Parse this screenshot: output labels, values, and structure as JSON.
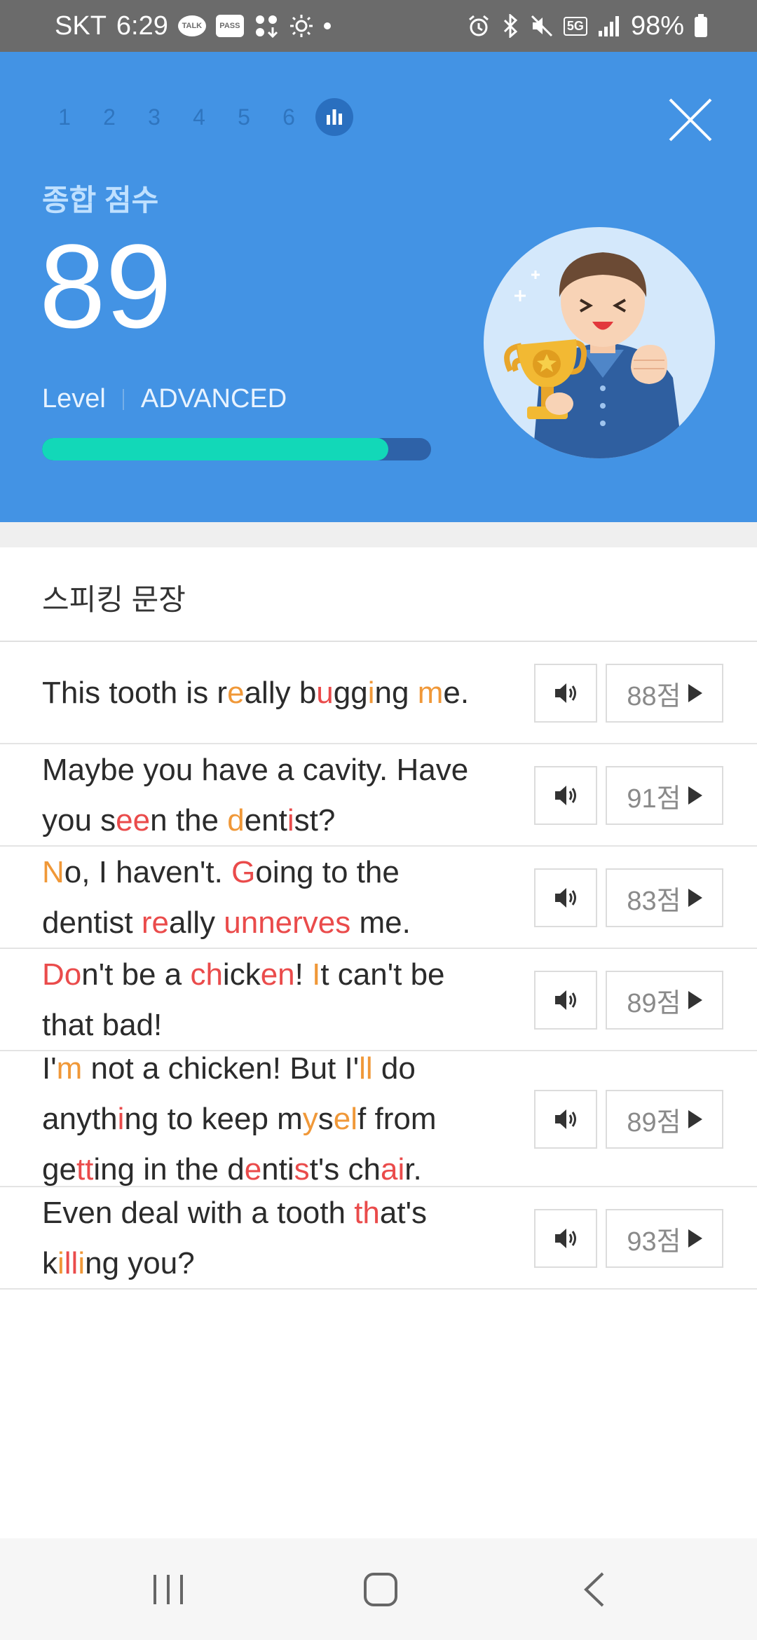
{
  "status_bar": {
    "carrier": "SKT",
    "time": "6:29",
    "talk_badge": "TALK",
    "pass_badge": "PASS",
    "network": "5G",
    "battery": "98%"
  },
  "header": {
    "steps": [
      "1",
      "2",
      "3",
      "4",
      "5",
      "6"
    ],
    "score_label": "종합 점수",
    "score": "89",
    "level_label": "Level",
    "level_value": "ADVANCED",
    "progress_fraction": 0.89,
    "colors": {
      "background": "#4393e4",
      "progress_fill": "#12d8b8",
      "progress_track": "#2e62a8"
    }
  },
  "section": {
    "title": "스피킹 문장"
  },
  "sentences": [
    {
      "score": "88점",
      "lines": [
        [
          [
            "This tooth is r",
            ""
          ],
          [
            "e",
            "o"
          ],
          [
            "ally b",
            ""
          ],
          [
            "u",
            "r"
          ],
          [
            "gg",
            ""
          ],
          [
            "i",
            "o"
          ],
          [
            "ng ",
            ""
          ],
          [
            "m",
            "o"
          ],
          [
            "e.",
            ""
          ]
        ]
      ]
    },
    {
      "score": "91점",
      "lines": [
        [
          [
            "Maybe you have a cavity. Have",
            ""
          ]
        ],
        [
          [
            "you s",
            ""
          ],
          [
            "ee",
            "r"
          ],
          [
            "n the ",
            ""
          ],
          [
            "d",
            "o"
          ],
          [
            "ent",
            ""
          ],
          [
            "i",
            "r"
          ],
          [
            "st?",
            ""
          ]
        ]
      ]
    },
    {
      "score": "83점",
      "lines": [
        [
          [
            "N",
            "o"
          ],
          [
            "o, I haven't. ",
            ""
          ],
          [
            "G",
            "r"
          ],
          [
            "oing to the",
            ""
          ]
        ],
        [
          [
            "dentist ",
            ""
          ],
          [
            "re",
            "r"
          ],
          [
            "ally ",
            ""
          ],
          [
            "unnerves",
            "r"
          ],
          [
            " me.",
            ""
          ]
        ]
      ]
    },
    {
      "score": "89점",
      "lines": [
        [
          [
            "Do",
            "r"
          ],
          [
            "n't be a ",
            ""
          ],
          [
            "ch",
            "r"
          ],
          [
            "ick",
            ""
          ],
          [
            "en",
            "r"
          ],
          [
            "! ",
            ""
          ],
          [
            "I",
            "o"
          ],
          [
            "t can't be",
            ""
          ]
        ],
        [
          [
            "that bad!",
            ""
          ]
        ]
      ]
    },
    {
      "score": "89점",
      "lines": [
        [
          [
            "I'",
            ""
          ],
          [
            "m",
            "o"
          ],
          [
            " not a chicken! But I'",
            ""
          ],
          [
            "ll",
            "o"
          ],
          [
            " do",
            ""
          ]
        ],
        [
          [
            "anyth",
            ""
          ],
          [
            "i",
            "r"
          ],
          [
            "ng to keep m",
            ""
          ],
          [
            "y",
            "o"
          ],
          [
            "s",
            ""
          ],
          [
            "el",
            "o"
          ],
          [
            "f from",
            ""
          ]
        ],
        [
          [
            "ge",
            ""
          ],
          [
            "tt",
            "r"
          ],
          [
            "ing in the d",
            ""
          ],
          [
            "e",
            "r"
          ],
          [
            "nti",
            ""
          ],
          [
            "s",
            "r"
          ],
          [
            "t's ch",
            ""
          ],
          [
            "ai",
            "r"
          ],
          [
            "r.",
            ""
          ]
        ]
      ]
    },
    {
      "score": "93점",
      "lines": [
        [
          [
            "Even deal with a tooth ",
            ""
          ],
          [
            "th",
            "r"
          ],
          [
            "at's",
            ""
          ]
        ],
        [
          [
            "k",
            ""
          ],
          [
            "i",
            "o"
          ],
          [
            "ll",
            "r"
          ],
          [
            "i",
            "o"
          ],
          [
            "ng you?",
            ""
          ]
        ]
      ]
    }
  ],
  "icons": {
    "speaker": "speaker-icon",
    "play": "play-triangle-icon",
    "close": "close-icon",
    "chart": "bar-chart-icon"
  },
  "highlight_colors": {
    "r": "#ea4b4b",
    "o": "#f09838"
  }
}
